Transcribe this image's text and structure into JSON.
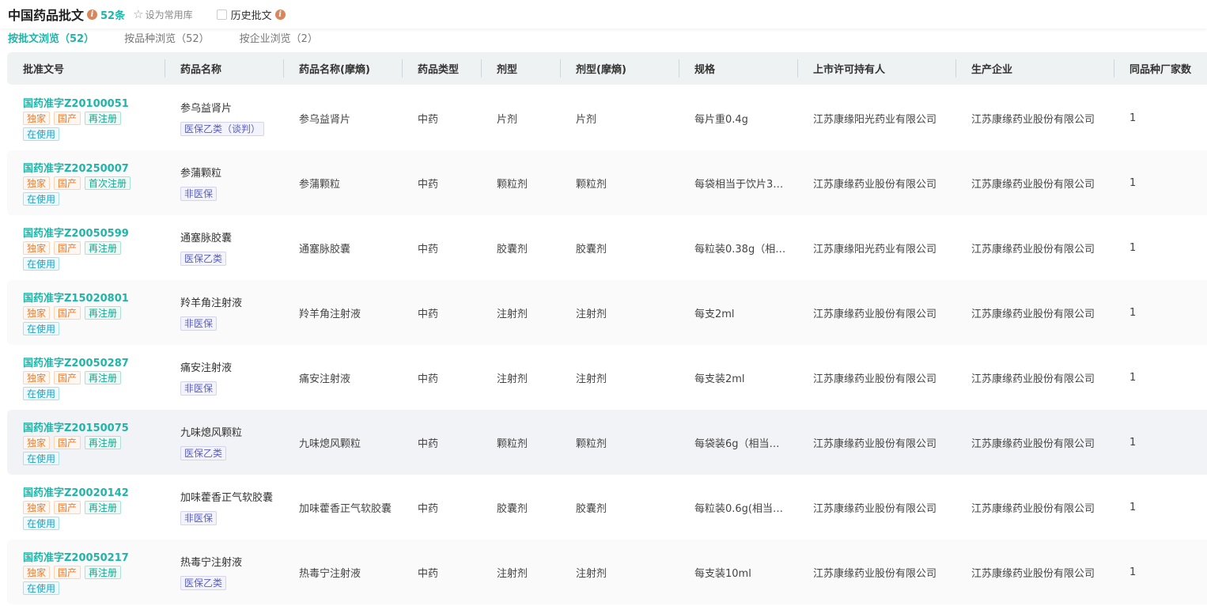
{
  "header": {
    "title": "中国药品批文",
    "count": "52条",
    "favorite_label": "设为常用库",
    "history_label": "历史批文",
    "info_icon": "i"
  },
  "tabs": [
    {
      "label": "按批文浏览（52）",
      "active": true
    },
    {
      "label": "按品种浏览（52）",
      "active": false
    },
    {
      "label": "按企业浏览（2）",
      "active": false
    }
  ],
  "columns": [
    "批准文号",
    "药品名称",
    "药品名称(摩熵)",
    "药品类型",
    "剂型",
    "剂型(摩熵)",
    "规格",
    "上市许可持有人",
    "生产企业",
    "同品种厂家数"
  ],
  "rows": [
    {
      "approval": "国药准字Z20100051",
      "tags": [
        "独家",
        "国产",
        "再注册"
      ],
      "status": "在使用",
      "name": "参乌益肾片",
      "insurance": "医保乙类（谈判）",
      "name_ms": "参乌益肾片",
      "type": "中药",
      "form": "片剂",
      "form_ms": "片剂",
      "spec": "每片重0.4g",
      "holder": "江苏康缘阳光药业有限公司",
      "maker": "江苏康缘药业股份有限公司",
      "count": "1"
    },
    {
      "approval": "国药准字Z20250007",
      "tags": [
        "独家",
        "国产",
        "首次注册"
      ],
      "status": "在使用",
      "name": "参蒲颗粒",
      "insurance": "非医保",
      "name_ms": "参蒲颗粒",
      "type": "中药",
      "form": "颗粒剂",
      "form_ms": "颗粒剂",
      "spec": "每袋相当于饮片3…",
      "holder": "江苏康缘药业股份有限公司",
      "maker": "江苏康缘药业股份有限公司",
      "count": "1"
    },
    {
      "approval": "国药准字Z20050599",
      "tags": [
        "独家",
        "国产",
        "再注册"
      ],
      "status": "在使用",
      "name": "通塞脉胶囊",
      "insurance": "医保乙类",
      "name_ms": "通塞脉胶囊",
      "type": "中药",
      "form": "胶囊剂",
      "form_ms": "胶囊剂",
      "spec": "每粒装0.38g（相…",
      "holder": "江苏康缘阳光药业有限公司",
      "maker": "江苏康缘药业股份有限公司",
      "count": "1"
    },
    {
      "approval": "国药准字Z15020801",
      "tags": [
        "独家",
        "国产",
        "再注册"
      ],
      "status": "在使用",
      "name": "羚羊角注射液",
      "insurance": "非医保",
      "name_ms": "羚羊角注射液",
      "type": "中药",
      "form": "注射剂",
      "form_ms": "注射剂",
      "spec": "每支2ml",
      "holder": "江苏康缘药业股份有限公司",
      "maker": "江苏康缘药业股份有限公司",
      "count": "1"
    },
    {
      "approval": "国药准字Z20050287",
      "tags": [
        "独家",
        "国产",
        "再注册"
      ],
      "status": "在使用",
      "name": "痛安注射液",
      "insurance": "非医保",
      "name_ms": "痛安注射液",
      "type": "中药",
      "form": "注射剂",
      "form_ms": "注射剂",
      "spec": "每支装2ml",
      "holder": "江苏康缘药业股份有限公司",
      "maker": "江苏康缘药业股份有限公司",
      "count": "1"
    },
    {
      "approval": "国药准字Z20150075",
      "tags": [
        "独家",
        "国产",
        "再注册"
      ],
      "status": "在使用",
      "name": "九味熄风颗粒",
      "insurance": "医保乙类",
      "name_ms": "九味熄风颗粒",
      "type": "中药",
      "form": "颗粒剂",
      "form_ms": "颗粒剂",
      "spec": "每袋装6g（相当…",
      "holder": "江苏康缘药业股份有限公司",
      "maker": "江苏康缘药业股份有限公司",
      "count": "1"
    },
    {
      "approval": "国药准字Z20020142",
      "tags": [
        "独家",
        "国产",
        "再注册"
      ],
      "status": "在使用",
      "name": "加味藿香正气软胶囊",
      "insurance": "非医保",
      "name_ms": "加味藿香正气软胶囊",
      "type": "中药",
      "form": "胶囊剂",
      "form_ms": "胶囊剂",
      "spec": "每粒装0.6g(相当…",
      "holder": "江苏康缘药业股份有限公司",
      "maker": "江苏康缘药业股份有限公司",
      "count": "1"
    },
    {
      "approval": "国药准字Z20050217",
      "tags": [
        "独家",
        "国产",
        "再注册"
      ],
      "status": "在使用",
      "name": "热毒宁注射液",
      "insurance": "医保乙类",
      "name_ms": "热毒宁注射液",
      "type": "中药",
      "form": "注射剂",
      "form_ms": "注射剂",
      "spec": "每支装10ml",
      "holder": "江苏康缘药业股份有限公司",
      "maker": "江苏康缘药业股份有限公司",
      "count": "1"
    }
  ]
}
